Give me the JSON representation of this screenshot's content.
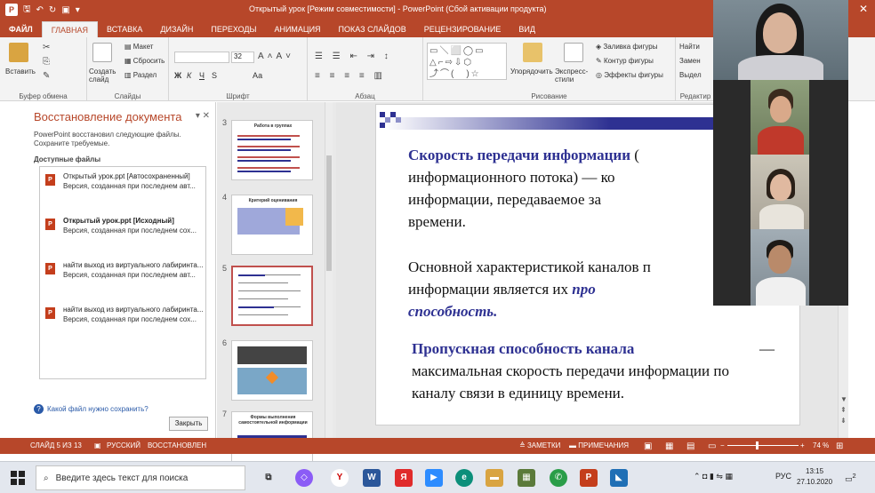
{
  "titlebar": {
    "title": "Открытый урок [Режим совместимости] - PowerPoint (Сбой активации продукта)",
    "app_logo": "P",
    "min": "—",
    "restore": "❐",
    "close": "✕"
  },
  "tabs": [
    {
      "label": "ФАЙЛ",
      "kind": "file"
    },
    {
      "label": "ГЛАВНАЯ",
      "kind": "active"
    },
    {
      "label": "ВСТАВКА",
      "kind": ""
    },
    {
      "label": "ДИЗАЙН",
      "kind": ""
    },
    {
      "label": "ПЕРЕХОДЫ",
      "kind": ""
    },
    {
      "label": "АНИМАЦИЯ",
      "kind": ""
    },
    {
      "label": "ПОКАЗ СЛАЙДОВ",
      "kind": ""
    },
    {
      "label": "РЕЦЕНЗИРОВАНИЕ",
      "kind": ""
    },
    {
      "label": "ВИД",
      "kind": ""
    }
  ],
  "ribbon": {
    "clipboard": {
      "label": "Буфер обмена",
      "paste": "Вставить"
    },
    "slides": {
      "label": "Слайды",
      "new_slide": "Создать слайд",
      "layout": "Макет",
      "reset": "Сбросить",
      "section": "Раздел"
    },
    "font": {
      "label": "Шрифт",
      "size": "32",
      "bold": "Ж",
      "italic": "К",
      "underline": "Ч",
      "strike": "S",
      "aa": "Аа"
    },
    "paragraph": {
      "label": "Абзац"
    },
    "drawing": {
      "label": "Рисование",
      "arrange": "Упорядочить",
      "quick_styles": "Экспресс-стили",
      "fill": "Заливка фигуры",
      "outline": "Контур фигуры",
      "effects": "Эффекты фигуры"
    },
    "editing": {
      "label": "Редактир",
      "find": "Найти",
      "replace": "Замен",
      "select": "Выдел"
    }
  },
  "recovery": {
    "title": "Восстановление документа",
    "desc": "PowerPoint восстановил следующие файлы. Сохраните требуемые.",
    "available": "Доступные файлы",
    "files": [
      {
        "name": "Открытый урок.ppt  [Автосохраненный]",
        "sub": "Версия, созданная при последнем авт...",
        "bold": false
      },
      {
        "name": "Открытый урок.ppt  [Исходный]",
        "sub": "Версия, созданная при последнем сох...",
        "bold": true
      },
      {
        "name": "найти выход из виртуального лабиринта...",
        "sub": "Версия, созданная при последнем авт...",
        "bold": false
      },
      {
        "name": "найти выход из виртуального лабиринта...",
        "sub": "Версия, созданная при последнем сох...",
        "bold": false
      }
    ],
    "help": "Какой файл нужно сохранить?",
    "close_btn": "Закрыть"
  },
  "thumbnails": [
    {
      "num": "3",
      "title": "Работа в группах"
    },
    {
      "num": "4",
      "title": "Критерий оценивания"
    },
    {
      "num": "5",
      "title": ""
    },
    {
      "num": "6",
      "title": ""
    },
    {
      "num": "7",
      "title": "Формы выполнения самостоятельной информации"
    }
  ],
  "slide": {
    "p1_bold": "Скорость передачи информации",
    "p1_rest_a": " (",
    "p1_line2": "информационного потока) — ко",
    "p1_line3": "информации, передаваемое за",
    "p1_line4": "времени.",
    "p2_line1": "Основной характеристикой каналов п",
    "p2_line2a": "информации является их ",
    "p2_line2b": "про",
    "p2_line3": "способность.",
    "p3_bold": "Пропускная способность канала",
    "p3_dash": " —",
    "p3_line2": "максимальная скорость передачи информации по",
    "p3_line3": "каналу связи в единицу времени."
  },
  "status": {
    "slide": "СЛАЙД 5 ИЗ 13",
    "lang": "РУССКИЙ",
    "state": "ВОССТАНОВЛЕН",
    "notes": "ЗАМЕТКИ",
    "comments": "ПРИМЕЧАНИЯ",
    "zoom": "74 %"
  },
  "taskbar": {
    "search_placeholder": "Введите здесь текст для поиска",
    "lang": "РУС",
    "time": "13:15",
    "date": "27.10.2020",
    "badge": "2"
  }
}
